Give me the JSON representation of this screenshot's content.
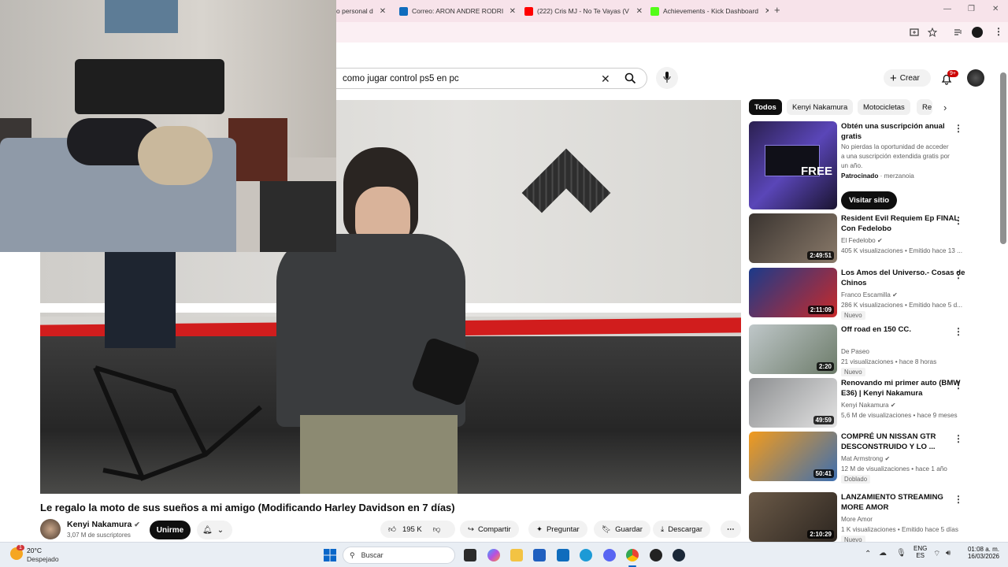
{
  "browser": {
    "tabs": [
      {
        "label": "o personal d",
        "icon": "page-icon",
        "color": "#d93025"
      },
      {
        "label": "Correo: ARON ANDRE RODRIGU",
        "icon": "outlook-icon",
        "color": "#0f6cbd"
      },
      {
        "label": "(222) Cris MJ - No Te Vayas (V",
        "icon": "youtube-icon",
        "color": "#ff0000"
      },
      {
        "label": "Achievements - Kick Dashboard",
        "icon": "kick-icon",
        "color": "#53fc18"
      }
    ],
    "new_tab": "+",
    "window_controls": [
      "—",
      "❐",
      "✕"
    ]
  },
  "youtube": {
    "search": {
      "value": "como jugar control ps5 en pc"
    },
    "create_label": "Crear",
    "notif_count": "9+",
    "chips": [
      "Todos",
      "Kenyi Nakamura",
      "Motocicletas",
      "Re"
    ],
    "video": {
      "title": "Le regalo la moto de sus sueños a mi amigo (Modificando Harley Davidson en 7 días)",
      "channel": "Kenyi Nakamura",
      "subscribers": "3,07 M de suscriptores",
      "join_label": "Unirme",
      "likes": "195 K",
      "share_label": "Compartir",
      "ask_label": "Preguntar",
      "save_label": "Guardar",
      "download_label": "Descargar"
    },
    "ad": {
      "title": "Obtén una suscripción anual gratis",
      "desc": "No pierdas la oportunidad de acceder a una suscripción extendida gratis por un año.",
      "sponsored": "Patrocinado",
      "advertiser": "merzanoia",
      "cta": "Visitar sitio",
      "thumb_text": "FREE"
    },
    "recommendations": [
      {
        "title": "Resident Evil Requiem Ep FINAL Con Fedelobo",
        "channel": "El Fedelobo",
        "meta": "405 K visualizaciones • Emitido hace 13 ...",
        "duration": "2:49:51",
        "badge": "",
        "verified": true,
        "colors": [
          "#3a3430",
          "#8a7a6a"
        ]
      },
      {
        "title": "Los Amos del Universo.- Cosas de Chinos",
        "channel": "Franco Escamilla",
        "meta": "286 K visualizaciones • Emitido hace 5 d...",
        "duration": "2:11:09",
        "badge": "Nuevo",
        "verified": true,
        "colors": [
          "#1b3a8a",
          "#c92a2a"
        ]
      },
      {
        "title": "Off road en 150 CC.",
        "channel": "De Paseo",
        "meta": "21 visualizaciones • hace 8 horas",
        "duration": "2:20",
        "badge": "Nuevo",
        "verified": false,
        "colors": [
          "#bfc7c9",
          "#6d7c6a"
        ]
      },
      {
        "title": "Renovando mi primer auto (BMW E36) | Kenyi Nakamura",
        "channel": "Kenyi Nakamura",
        "meta": "5,6 M de visualizaciones • hace 9 meses",
        "duration": "49:59",
        "badge": "",
        "verified": true,
        "colors": [
          "#8d8f91",
          "#e3e3e3"
        ]
      },
      {
        "title": "COMPRÉ UN NISSAN GTR DESCONSTRUIDO Y LO ...",
        "channel": "Mat Armstrong",
        "meta": "12 M de visualizaciones • hace 1 año",
        "duration": "50:41",
        "badge": "Doblado",
        "verified": true,
        "colors": [
          "#f29b1d",
          "#3d6fb0"
        ]
      },
      {
        "title": "LANZAMIENTO STREAMING MORE AMOR",
        "channel": "More Amor",
        "meta": "1 K visualizaciones • Emitido hace 5 días",
        "duration": "2:10:29",
        "badge": "Nuevo",
        "verified": false,
        "colors": [
          "#6b5a48",
          "#2d2620"
        ]
      }
    ]
  },
  "taskbar": {
    "weather_temp": "20°C",
    "weather_desc": "Despejado",
    "search_label": "Buscar",
    "lang": "ENG",
    "region": "ES",
    "time": "01:08 a. m.",
    "date": "16/03/2026",
    "weather_badge": "1"
  }
}
